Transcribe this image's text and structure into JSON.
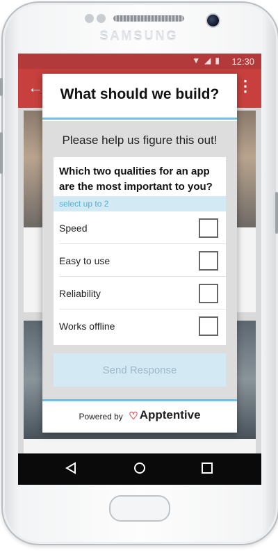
{
  "device": {
    "brand": "SAMSUNG"
  },
  "status_bar": {
    "time": "12:30",
    "icons": [
      "wifi-icon",
      "signal-icon",
      "battery-icon"
    ]
  },
  "survey": {
    "title": "What should we build?",
    "intro": "Please help us figure this out!",
    "question": "Which two qualities for an app are the most important to you?",
    "hint": "select up to 2",
    "options": [
      {
        "label": "Speed",
        "checked": false
      },
      {
        "label": "Easy to use",
        "checked": false
      },
      {
        "label": "Reliability",
        "checked": false
      },
      {
        "label": "Works offline",
        "checked": false
      }
    ],
    "send_label": "Send Response"
  },
  "footer": {
    "powered_by": "Powered by",
    "brand_name": "Apptentive"
  },
  "colors": {
    "accent": "#6ec1e4",
    "appbar": "#c7403d",
    "statusbar": "#b33a3a",
    "send_button": "#d3e9f3"
  }
}
